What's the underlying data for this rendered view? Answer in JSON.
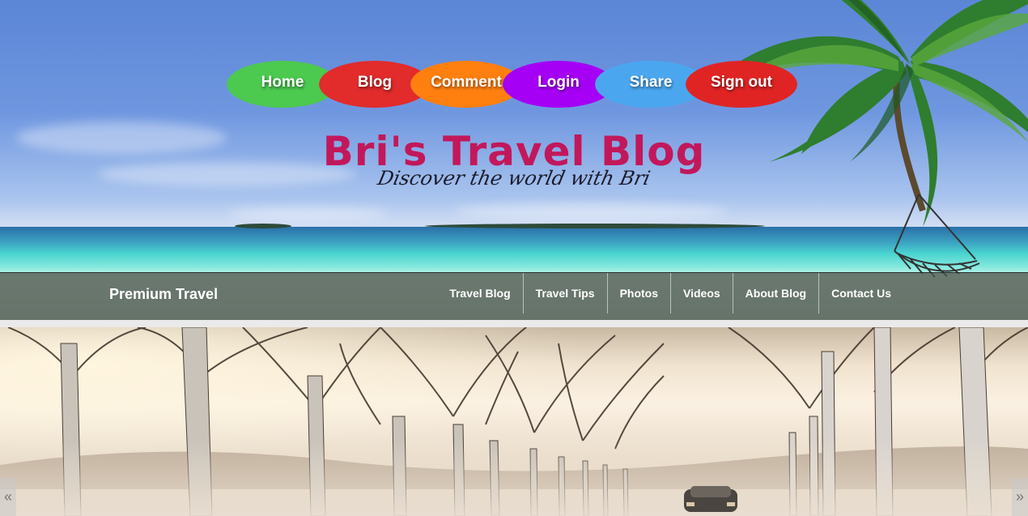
{
  "menu": [
    {
      "label": "Home",
      "color": "#4cc94f"
    },
    {
      "label": "Blog",
      "color": "#e22b2b"
    },
    {
      "label": "Comment",
      "color": "#ff7f0f"
    },
    {
      "label": "Login",
      "color": "#a500f5"
    },
    {
      "label": "Share",
      "color": "#4aa7ef"
    },
    {
      "label": "Sign out",
      "color": "#e02424"
    }
  ],
  "site": {
    "title": "Bri's Travel Blog",
    "tagline": "Discover the world with Bri"
  },
  "navbar": {
    "brand": "Premium Travel",
    "links": [
      "Travel Blog",
      "Travel Tips",
      "Photos",
      "Videos",
      "About Blog",
      "Contact Us"
    ]
  },
  "slider": {
    "prev_icon": "«",
    "next_icon": "»"
  },
  "colors": {
    "title": "#c2185b",
    "tagline": "#1b1b2a"
  }
}
